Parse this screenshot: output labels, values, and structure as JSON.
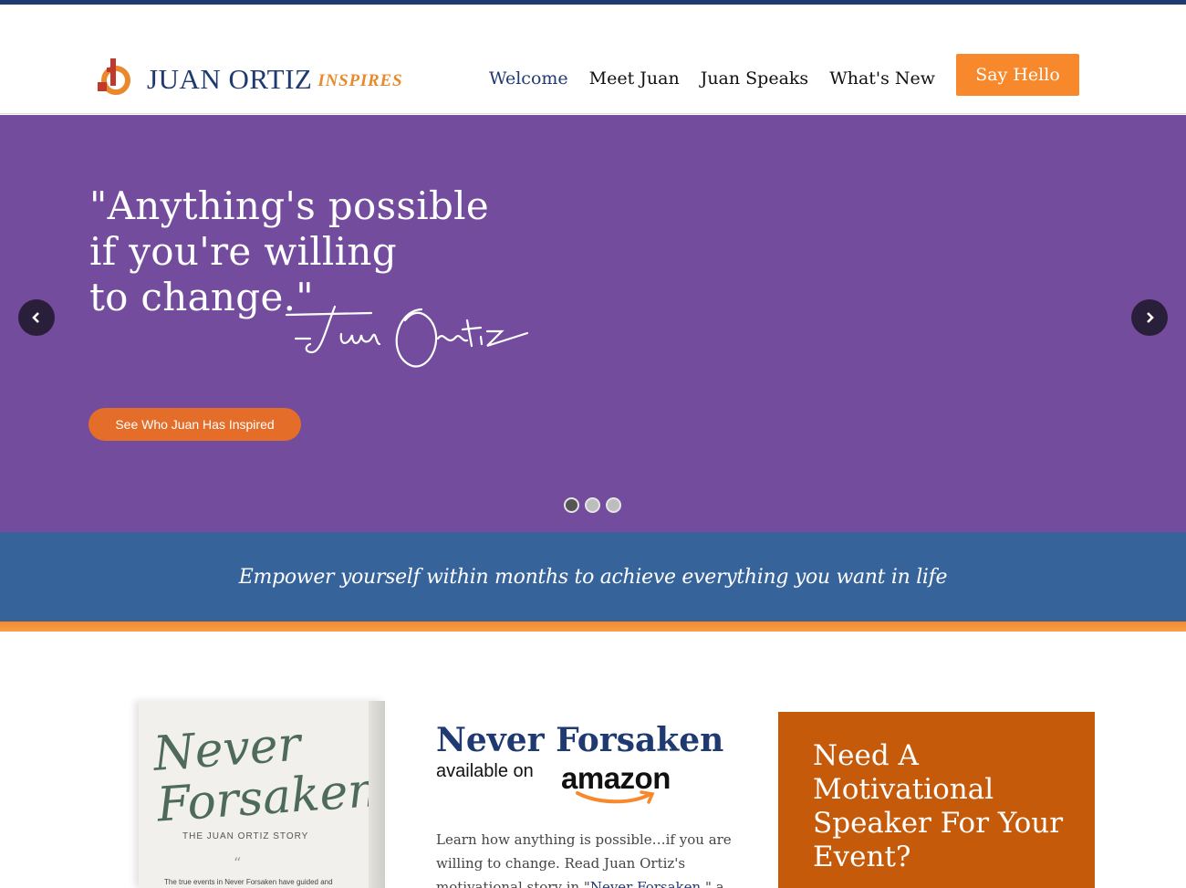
{
  "header": {
    "logo_name": "JUAN ORTIZ",
    "logo_tagline": "INSPIRES",
    "nav": [
      {
        "label": "Welcome",
        "active": true
      },
      {
        "label": "Meet Juan",
        "active": false
      },
      {
        "label": "Juan Speaks",
        "active": false
      },
      {
        "label": "What's New",
        "active": false
      }
    ],
    "cta_label": "Say Hello"
  },
  "hero": {
    "quote_lines": [
      "\"Anything's possible",
      "if you're willing",
      "to change.\""
    ],
    "button_label": "See Who Juan Has Inspired",
    "slide_count": 3,
    "active_slide": 1
  },
  "band": {
    "tagline": "Empower yourself within months to achieve everything you want in life"
  },
  "book": {
    "cover_title": "Never Forsaken",
    "cover_subtitle": "THE JUAN ORTIZ STORY",
    "cover_blurb": "The true events in Never Forsaken have guided and"
  },
  "promo": {
    "title": "Never Forsaken",
    "available_on": "available on",
    "amazon": "amazon",
    "body_text": "Learn how anything is possible…if you are willing to change. Read Juan Ortiz's motivational story in \"",
    "body_link": "Never Forsaken",
    "body_tail": ",\" a"
  },
  "speaker_cta": {
    "heading": "Need A Motivational Speaker For Your Event?"
  },
  "colors": {
    "navy": "#1f3a70",
    "orange": "#f7892c",
    "purple": "#744c9e",
    "blue_band": "#35639a",
    "burnt_orange": "#c55a0b"
  }
}
